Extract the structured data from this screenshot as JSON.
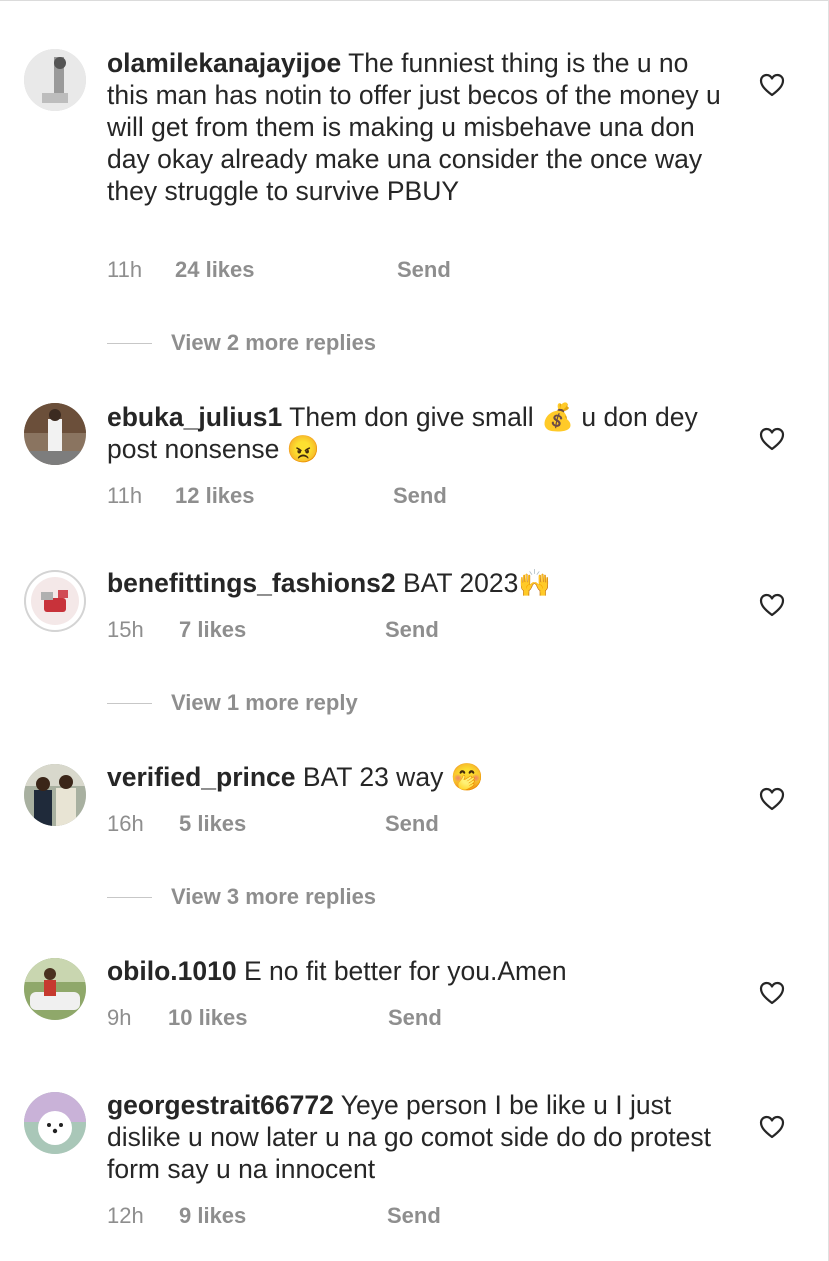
{
  "comments": [
    {
      "username": "olamilekanajayijoe",
      "text": " The funniest thing is the u no this man has notin to offer just becos of the money u will get from them is making u misbehave una don day okay already make una consider the once way they struggle to survive PBUY",
      "time": "11h",
      "likes": "24 likes",
      "send": "Send",
      "replies": "View 2 more replies"
    },
    {
      "username": "ebuka_julius1",
      "text": " Them don give small 💰 u don dey post nonsense 😠",
      "time": "11h",
      "likes": "12 likes",
      "send": "Send"
    },
    {
      "username": "benefittings_fashions2",
      "text": " BAT 2023🙌",
      "time": "15h",
      "likes": "7 likes",
      "send": "Send",
      "replies": "View 1 more reply"
    },
    {
      "username": "verified_prince",
      "text": " BAT 23 way 🤭",
      "time": "16h",
      "likes": "5 likes",
      "send": "Send",
      "replies": "View 3 more replies"
    },
    {
      "username": "obilo.1010",
      "text": " E no fit better for you.Amen",
      "time": "9h",
      "likes": "10 likes",
      "send": "Send"
    },
    {
      "username": "georgestrait66772",
      "text": " Yeye person I be like u I just dislike u now later u na go comot side do do protest form say u na innocent",
      "time": "12h",
      "likes": "9 likes",
      "send": "Send"
    }
  ],
  "icons": {
    "like": "heart-outline-icon",
    "avatar": "profile-photo"
  },
  "colors": {
    "text": "#262626",
    "muted": "#8e8e8e",
    "divider": "#c7c7c7"
  }
}
